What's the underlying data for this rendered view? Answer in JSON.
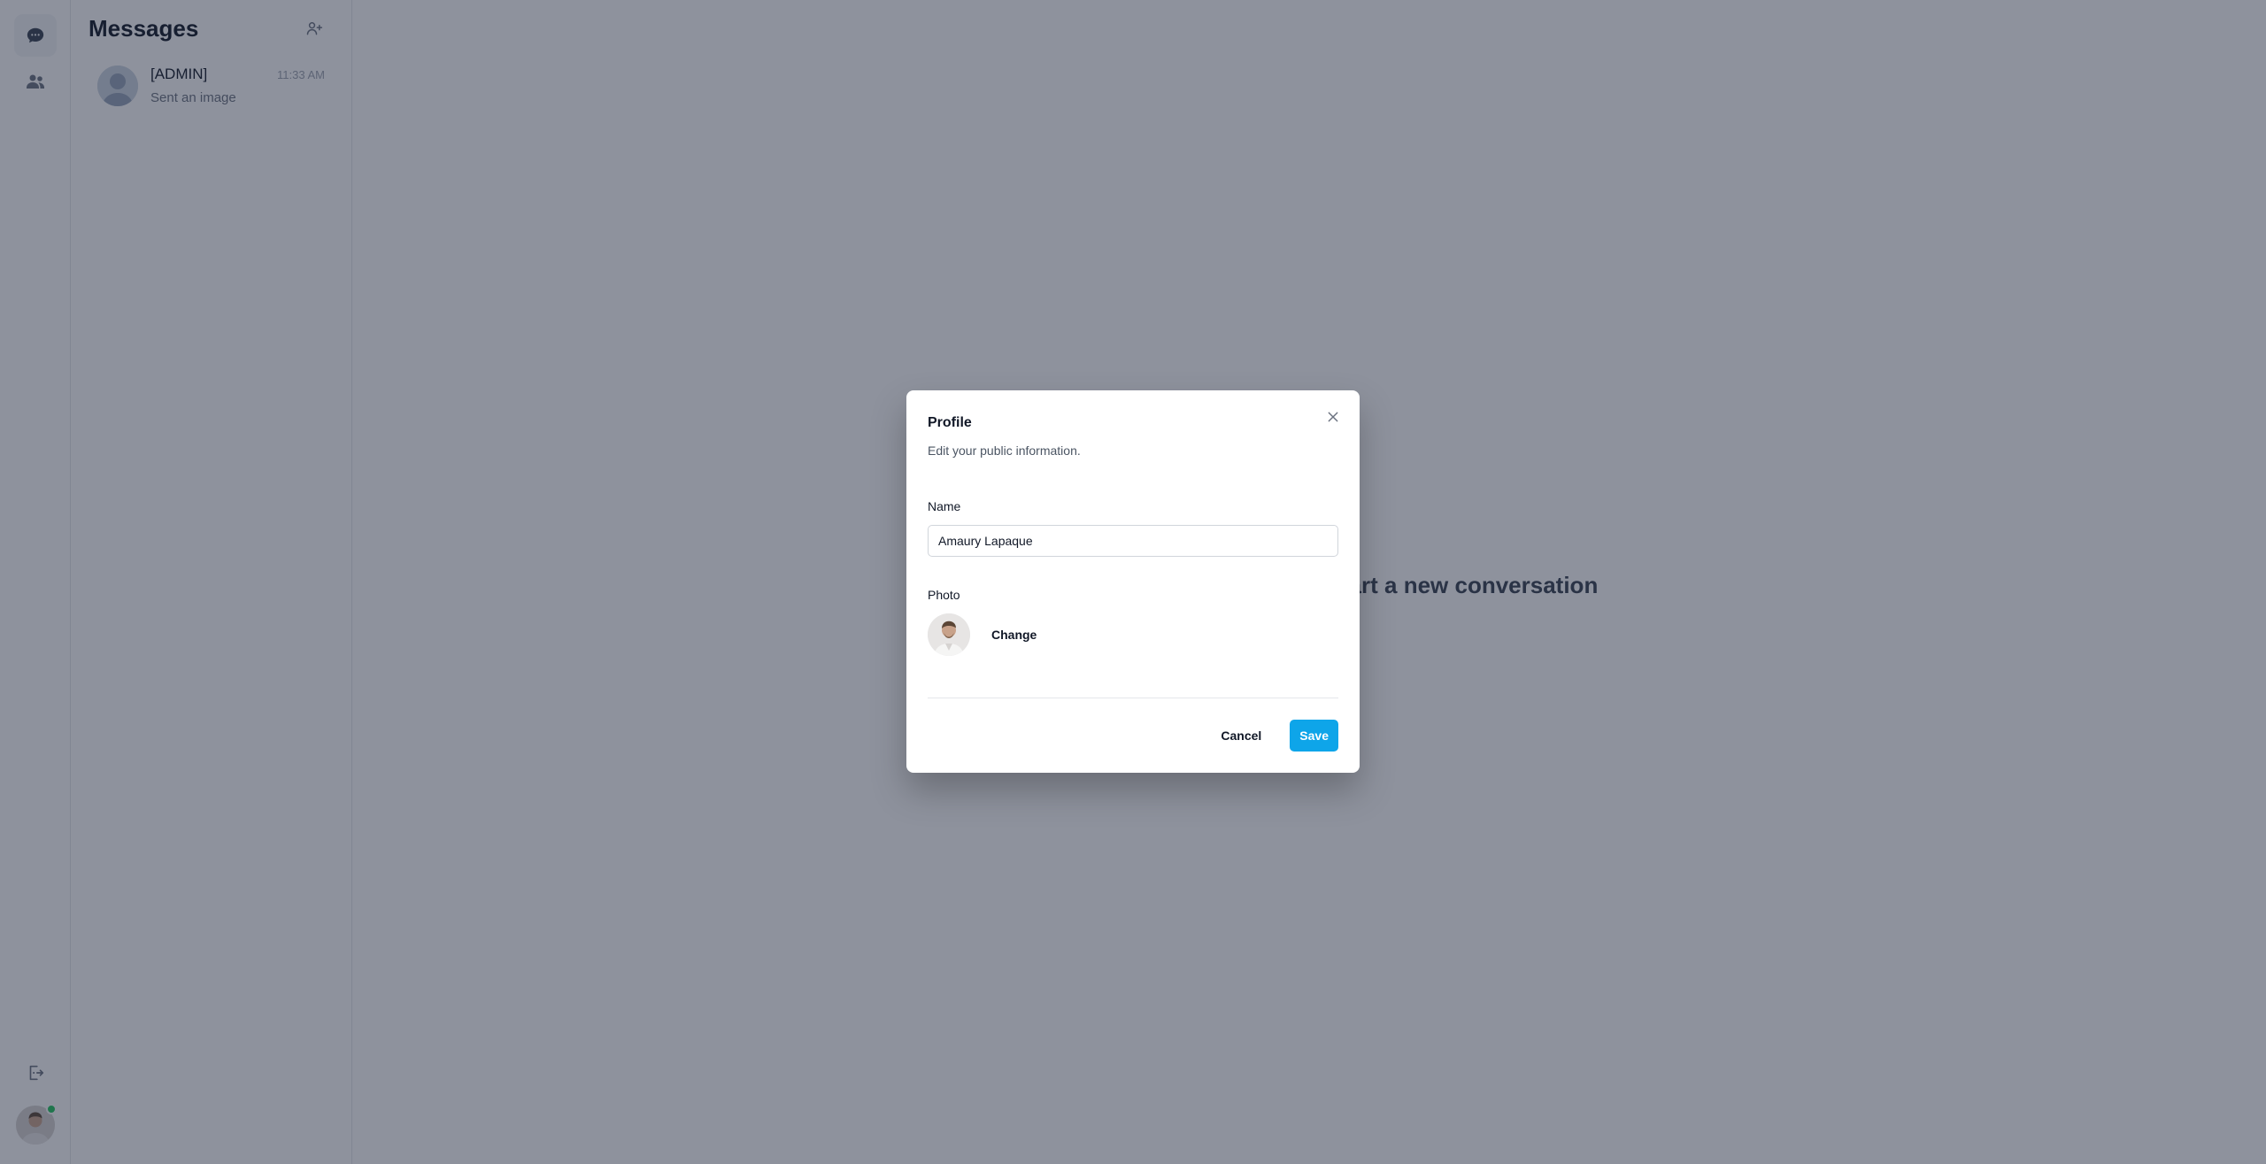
{
  "sidebar": {
    "items": [
      {
        "icon": "chat-bubble-icon",
        "active": true
      },
      {
        "icon": "users-icon",
        "active": false
      }
    ],
    "logout_icon": "logout-icon",
    "user_status_color": "#22c55e"
  },
  "conversations": {
    "title": "Messages",
    "new_chat_icon": "add-user-icon",
    "items": [
      {
        "name": "[ADMIN]",
        "time": "11:33 AM",
        "preview": "Sent an image"
      }
    ]
  },
  "main": {
    "empty_state": "Select a conversation or start a new conversation"
  },
  "profile_modal": {
    "title": "Profile",
    "subtitle": "Edit your public information.",
    "name_label": "Name",
    "name_value": "Amaury Lapaque",
    "photo_label": "Photo",
    "change_label": "Change",
    "cancel_label": "Cancel",
    "save_label": "Save",
    "accent_color": "#0ea5e9"
  }
}
